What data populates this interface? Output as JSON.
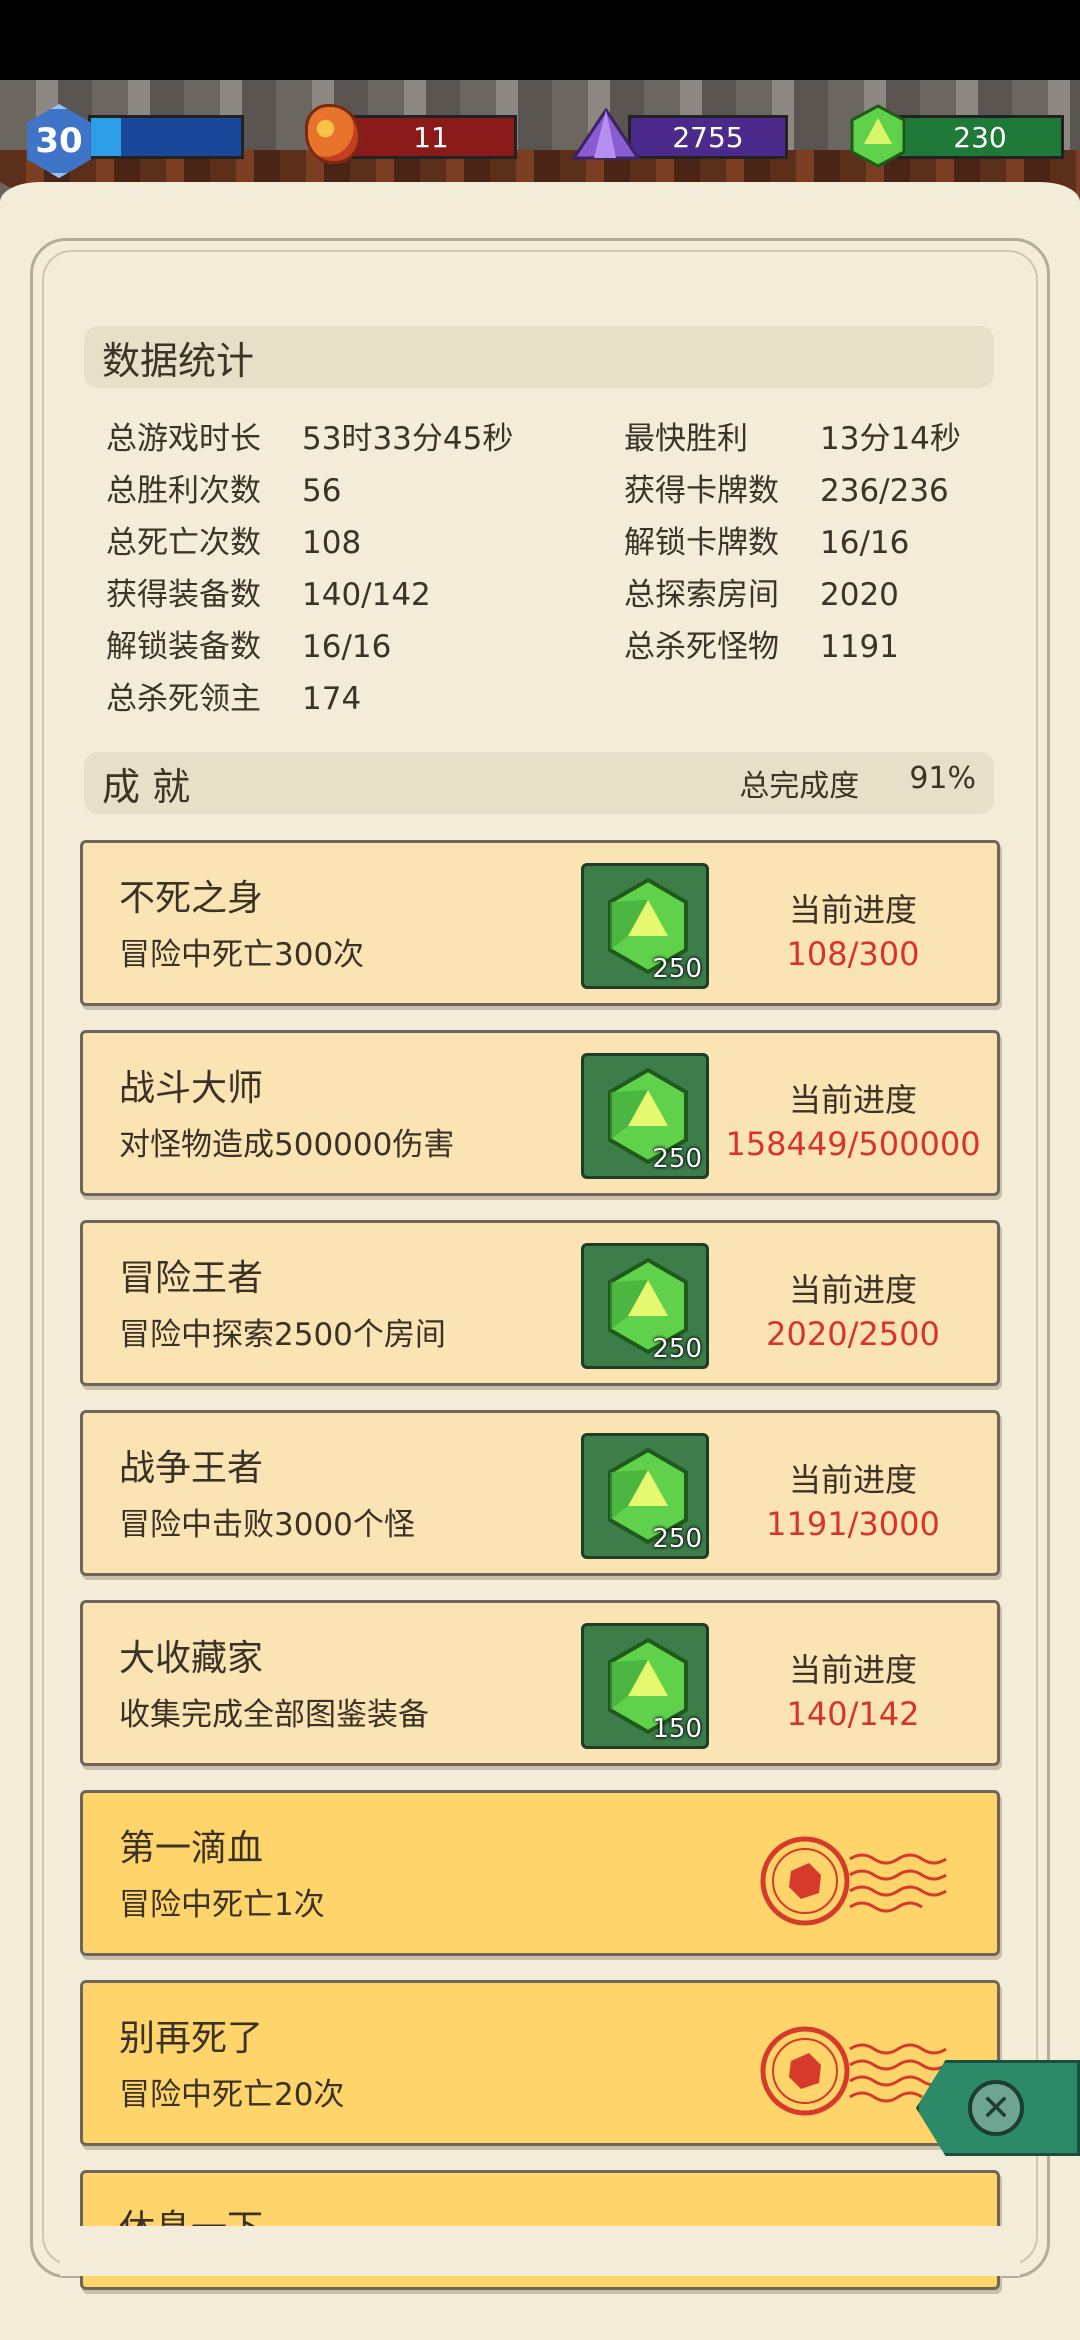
{
  "hud": {
    "level": "30",
    "xp_progress": 0.2,
    "ore_count": "11",
    "crystal_count": "2755",
    "gem_count": "230"
  },
  "stats": {
    "title": "数据统计",
    "items": [
      {
        "label": "总游戏时长",
        "value": "53时33分45秒"
      },
      {
        "label": "最快胜利",
        "value": "13分14秒"
      },
      {
        "label": "总胜利次数",
        "value": "56"
      },
      {
        "label": "获得卡牌数",
        "value": "236/236"
      },
      {
        "label": "总死亡次数",
        "value": "108"
      },
      {
        "label": "解锁卡牌数",
        "value": "16/16"
      },
      {
        "label": "获得装备数",
        "value": "140/142"
      },
      {
        "label": "总探索房间",
        "value": "2020"
      },
      {
        "label": "解锁装备数",
        "value": "16/16"
      },
      {
        "label": "总杀死怪物",
        "value": "1191"
      },
      {
        "label": "总杀死领主",
        "value": "174"
      }
    ]
  },
  "achievements": {
    "title": "成 就",
    "completion_label": "总完成度",
    "completion_value": "91%",
    "progress_label": "当前进度",
    "cards": [
      {
        "name": "不死之身",
        "desc": "冒险中死亡300次",
        "reward": "250",
        "progress": "108/300"
      },
      {
        "name": "战斗大师",
        "desc": "对怪物造成500000伤害",
        "reward": "250",
        "progress": "158449/500000"
      },
      {
        "name": "冒险王者",
        "desc": "冒险中探索2500个房间",
        "reward": "250",
        "progress": "2020/2500"
      },
      {
        "name": "战争王者",
        "desc": "冒险中击败3000个怪",
        "reward": "250",
        "progress": "1191/3000"
      },
      {
        "name": "大收藏家",
        "desc": "收集完成全部图鉴装备",
        "reward": "150",
        "progress": "140/142"
      }
    ],
    "completed": [
      {
        "name": "第一滴血",
        "desc": "冒险中死亡1次"
      },
      {
        "name": "别再死了",
        "desc": "冒险中死亡20次"
      },
      {
        "name": "休息一下",
        "desc": ""
      }
    ]
  }
}
